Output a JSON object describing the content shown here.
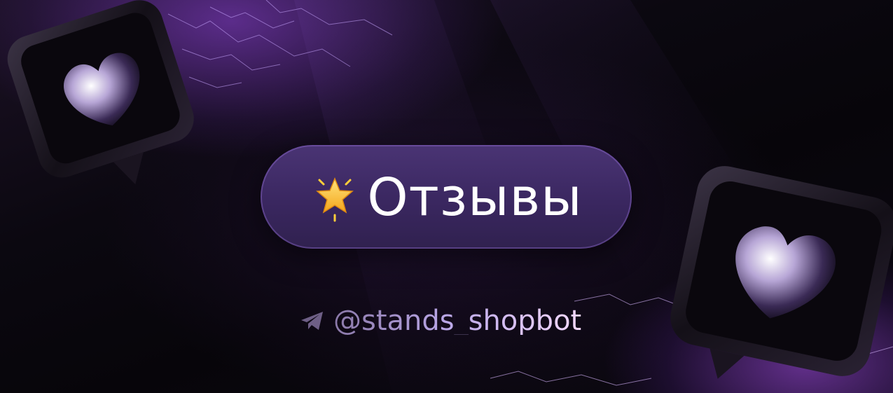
{
  "banner": {
    "title": "Отзывы",
    "title_icon": "glowing-star-icon",
    "handle_icon": "telegram-icon",
    "handle": "@stands_shopbot",
    "decor_icons": [
      "heart-notification-icon",
      "heart-notification-icon"
    ]
  },
  "colors": {
    "background": "#07050a",
    "pill": "#3a2760",
    "accent_purple": "#9a4fe6",
    "title_text": "#ffffff",
    "handle_gradient_start": "#8a78a8",
    "handle_gradient_end": "#f3d8ff"
  }
}
